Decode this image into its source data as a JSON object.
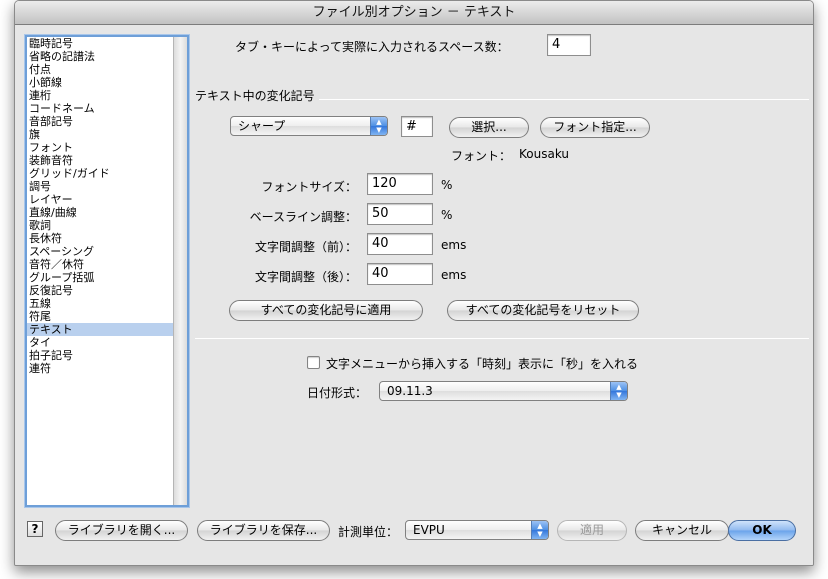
{
  "window": {
    "title": "ファイル別オプション － テキスト"
  },
  "sidebar": {
    "items": [
      "臨時記号",
      "省略の記譜法",
      "付点",
      "小節線",
      "連桁",
      "コードネーム",
      "音部記号",
      "旗",
      "フォント",
      "装飾音符",
      "グリッド/ガイド",
      "調号",
      "レイヤー",
      "直線/曲線",
      "歌詞",
      "長休符",
      "スペーシング",
      "音符／休符",
      "グループ括弧",
      "反復記号",
      "五線",
      "符尾",
      "テキスト",
      "タイ",
      "拍子記号",
      "連符"
    ],
    "selected": "テキスト"
  },
  "tab": {
    "label": "タブ・キーによって実際に入力されるスペース数：",
    "value": "4"
  },
  "accidentals": {
    "section_title": "テキスト中の変化記号",
    "type_select": "シャープ",
    "symbol_value": "#",
    "select_button": "選択...",
    "font_button": "フォント指定...",
    "font_label": "フォント：",
    "font_name": "Kousaku",
    "size_label": "フォントサイズ：",
    "size_value": "120",
    "size_unit": "%",
    "baseline_label": "ベースライン調整：",
    "baseline_value": "50",
    "baseline_unit": "%",
    "kern_before_label": "文字間調整（前）：",
    "kern_before_value": "40",
    "kern_before_unit": "ems",
    "kern_after_label": "文字間調整（後）：",
    "kern_after_value": "40",
    "kern_after_unit": "ems",
    "apply_all_button": "すべての変化記号に適用",
    "reset_all_button": "すべての変化記号をリセット"
  },
  "time_option": {
    "label": "文字メニューから挿入する「時刻」表示に「秒」を入れる",
    "checked": false
  },
  "date_format": {
    "label": "日付形式：",
    "value": "09.11.3"
  },
  "footer": {
    "help": "?",
    "open_library": "ライブラリを開く...",
    "save_library": "ライブラリを保存...",
    "units_label": "計測単位：",
    "units_value": "EVPU",
    "apply": "適用",
    "cancel": "キャンセル",
    "ok": "OK"
  }
}
